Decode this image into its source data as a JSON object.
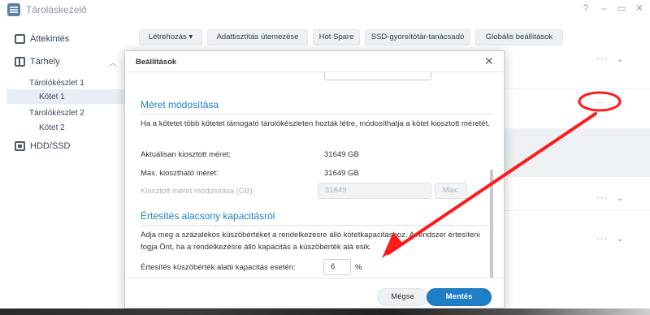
{
  "app": {
    "title": "Tároláskezelő",
    "controls": [
      "?",
      "–",
      "▭",
      "✕"
    ]
  },
  "sidebar": {
    "items": [
      {
        "label": "Áttekintés",
        "icon": "overview-icon"
      },
      {
        "label": "Tárhely",
        "icon": "storage-icon"
      },
      {
        "label": "HDD/SSD",
        "icon": "hdd-icon"
      }
    ],
    "pools": [
      {
        "label": "Tárolókészlet 1",
        "volume": "Kötet 1"
      },
      {
        "label": "Tárolókészlet 2",
        "volume": "Kötet 2"
      }
    ]
  },
  "toolbar": {
    "create_label": "Létrehozás",
    "scrub_label": "Adattisztítás ütemezése",
    "hotspare_label": "Hot Spare",
    "ssdcache_label": "SSD-gyorsítótár-tanácsadó",
    "global_label": "Globális beállítások"
  },
  "right_panel": {
    "more_label": "···",
    "expand_label": "⌄"
  },
  "dialog": {
    "title": "Beállítások",
    "close_label": "✕",
    "resize_section": {
      "title": "Méret módosítása",
      "description": "Ha a kötetet több kötetet támogató tárolókészleten hozták létre, módosíthatja a kötet kiosztott méretét.",
      "allocated_label": "Aktuálisan kiosztott méret:",
      "allocated_value": "31649 GB",
      "max_label": "Max. kiosztható méret:",
      "max_value": "31649 GB",
      "modify_label": "Kiosztott méret módosítása (GB):",
      "modify_value": "31649",
      "max_button": "Max."
    },
    "notify_section": {
      "title": "Értesítés alacsony kapacitásról",
      "description": "Adja meg a százalékos küszöbértéket a rendelkezésre álló kötetkapacitáshoz. A rendszer értesíteni fogja Önt, ha a rendelkezésre álló kapacitás a küszöbérték alá esik.",
      "threshold_label": "Értesítés küszöbérték alatti kapacitás esetén:",
      "threshold_value": "6",
      "threshold_unit": "%"
    },
    "cancel_label": "Mégse",
    "save_label": "Mentés"
  },
  "colors": {
    "accent": "#1e7ec8",
    "annotation": "#ff1a1a"
  }
}
